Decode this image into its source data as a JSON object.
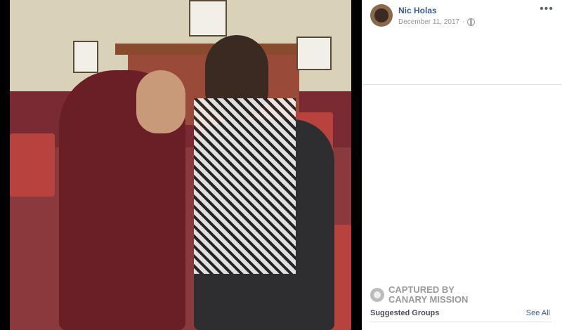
{
  "post": {
    "author": "Nic Holas",
    "date": "December 11, 2017",
    "more_label": "•••"
  },
  "watermark": {
    "line1": "CAPTURED BY",
    "line2": "CANARY MISSION"
  },
  "sidebar": {
    "suggested_groups": "Suggested Groups",
    "see_all": "See All"
  },
  "colors": {
    "link": "#385898",
    "meta": "#90949c"
  }
}
